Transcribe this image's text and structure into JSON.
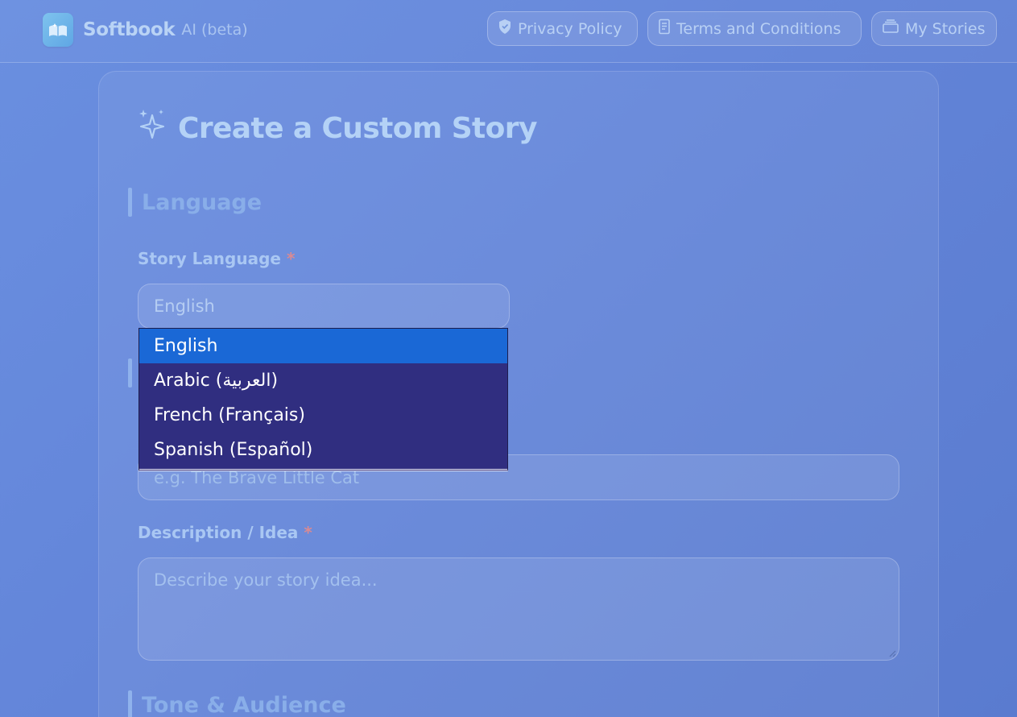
{
  "header": {
    "brand_name": "Softbook",
    "brand_suffix": "AI (beta)",
    "nav": [
      {
        "label": "Privacy Policy",
        "icon": "shield-icon"
      },
      {
        "label": "Terms and Conditions",
        "icon": "document-icon"
      },
      {
        "label": "My Stories",
        "icon": "stack-icon"
      }
    ]
  },
  "form": {
    "title": "Create a Custom Story",
    "title_icon": "sparkles-icon",
    "sections": {
      "language": "Language",
      "tone": "Tone & Audience"
    },
    "language_field": {
      "label": "Story Language",
      "required_mark": "*",
      "selected": "English",
      "options": [
        "English",
        "Arabic (العربية)",
        "French (Français)",
        "Spanish (Español)"
      ]
    },
    "title_field": {
      "placeholder": "e.g. The Brave Little Cat"
    },
    "description_field": {
      "label": "Description / Idea",
      "required_mark": "*",
      "placeholder": "Describe your story idea..."
    }
  },
  "colors": {
    "background": "#6385d9",
    "dropdown_bg": "#302e80",
    "dropdown_selected": "#1a68d6",
    "required": "#d98a93"
  }
}
